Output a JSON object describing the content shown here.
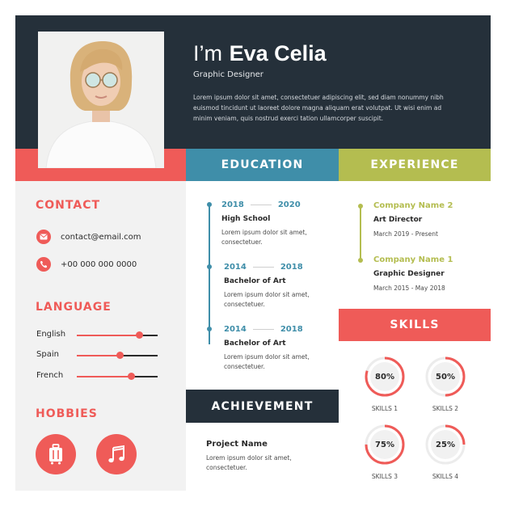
{
  "header": {
    "greeting": "I’m",
    "name": "Eva Celia",
    "role": "Graphic Designer",
    "bio": "Lorem ipsum dolor sit amet, consectetuer adipiscing elit, sed diam nonummy nibh euismod tincidunt ut laoreet dolore magna aliquam erat volutpat. Ut wisi enim ad minim veniam, quis nostrud exerci tation ullamcorper suscipit."
  },
  "sections": {
    "education": "EDUCATION",
    "experience": "EXPERIENCE",
    "contact": "CONTACT",
    "language": "LANGUAGE",
    "hobbies": "HOBBIES",
    "skills": "SKILLS",
    "achievement": "ACHIEVEMENT"
  },
  "contact": {
    "email": "contact@email.com",
    "phone": "+00 000 000 0000"
  },
  "languages": [
    {
      "name": "English",
      "level": 0.77
    },
    {
      "name": "Spain",
      "level": 0.53
    },
    {
      "name": "French",
      "level": 0.67
    }
  ],
  "hobbies": [
    {
      "icon": "luggage-icon"
    },
    {
      "icon": "music-note-icon"
    }
  ],
  "education": [
    {
      "start": "2018",
      "end": "2020",
      "degree": "High School",
      "desc": "Lorem ipsum dolor sit amet, consectetuer."
    },
    {
      "start": "2014",
      "end": "2018",
      "degree": "Bachelor of Art",
      "desc": "Lorem ipsum dolor sit amet, consectetuer."
    },
    {
      "start": "2014",
      "end": "2018",
      "degree": "Bachelor of Art",
      "desc": "Lorem ipsum dolor sit amet, consectetuer."
    }
  ],
  "experience": [
    {
      "company": "Company Name 2",
      "role": "Art Director",
      "dates": "March 2019 - Present"
    },
    {
      "company": "Company Name 1",
      "role": "Graphic Designer",
      "dates": "March 2015 - May 2018"
    }
  ],
  "skills": [
    {
      "value": "80%",
      "percent": 80,
      "label": "SKILLS 1"
    },
    {
      "value": "50%",
      "percent": 50,
      "label": "SKILLS 2"
    },
    {
      "value": "75%",
      "percent": 75,
      "label": "SKILLS 3"
    },
    {
      "value": "25%",
      "percent": 25,
      "label": "SKILLS 4"
    }
  ],
  "achievement": {
    "title": "Project Name",
    "desc": "Lorem ipsum dolor sit amet, consectetuer."
  },
  "colors": {
    "dark": "#25303a",
    "coral": "#ef5b58",
    "teal": "#3f8ea9",
    "olive": "#b4bd50",
    "panel": "#f2f2f2"
  }
}
